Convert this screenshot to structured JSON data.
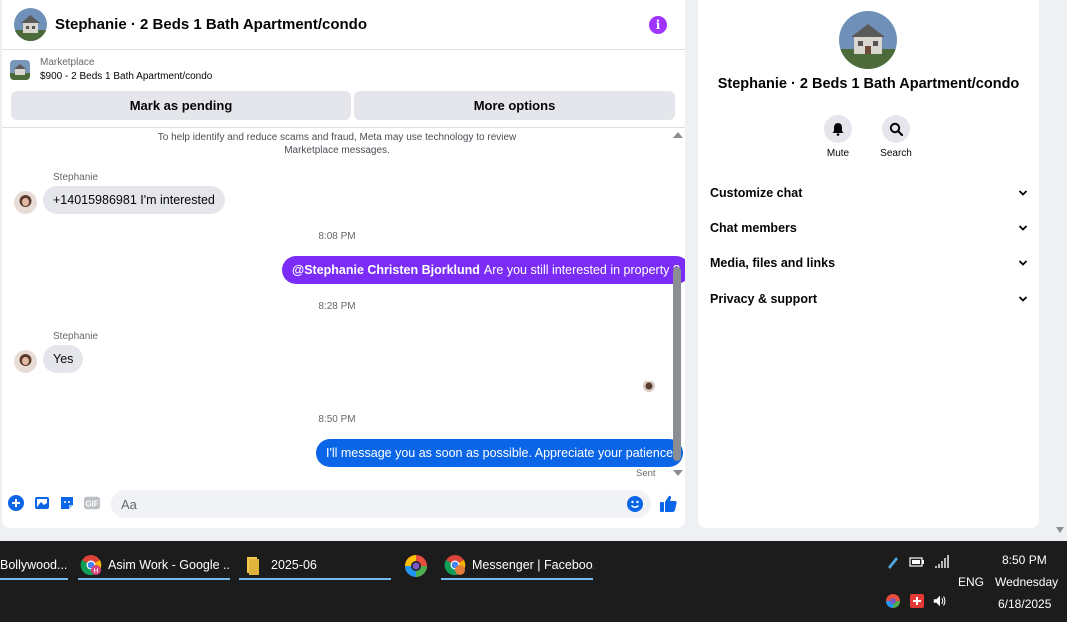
{
  "chat": {
    "title": "Stephanie · 2 Beds 1 Bath Apartment/condo",
    "listing_kicker": "Marketplace",
    "listing_price": "$900 - 2 Beds 1 Bath Apartment/condo",
    "mark_pending_label": "Mark as pending",
    "more_options_label": "More options",
    "notice": "To help identify and reduce scams and fraud, Meta may use technology to review Marketplace messages.",
    "messages": [
      {
        "sender": "Stephanie",
        "text": "+14015986981 I'm interested"
      },
      {
        "time": "8:08 PM"
      },
      {
        "mention": "@Stephanie Christen Bjorklund",
        "text": "Are you still interested in property ?"
      },
      {
        "time": "8:28 PM"
      },
      {
        "sender": "Stephanie",
        "text": "Yes"
      },
      {
        "time": "8:50 PM"
      },
      {
        "text": "I'll message you as soon as possible. Appreciate your patience",
        "status": "Sent"
      }
    ],
    "composer_placeholder": "Aa"
  },
  "right_panel": {
    "title": "Stephanie · 2 Beds 1 Bath Apartment/condo",
    "actions": [
      {
        "label": "Mute",
        "icon": "bell-icon"
      },
      {
        "label": "Search",
        "icon": "search-icon"
      }
    ],
    "menu": [
      {
        "label": "Customize chat"
      },
      {
        "label": "Chat members"
      },
      {
        "label": "Media, files and links"
      },
      {
        "label": "Privacy & support"
      }
    ]
  },
  "taskbar": {
    "items": [
      {
        "label": "Bollywood..."
      },
      {
        "label": "Asim Work - Google ...",
        "badge": "H"
      },
      {
        "label": "2025-06"
      },
      {
        "label": ""
      },
      {
        "label": "Messenger | Faceboo..."
      }
    ],
    "lang": "ENG",
    "time": "8:50 PM",
    "day": "Wednesday",
    "date": "6/18/2025"
  },
  "colors": {
    "accent_blue": "#0a66e6",
    "accent_purple": "#7b2df7",
    "info_purple": "#a033ff"
  }
}
